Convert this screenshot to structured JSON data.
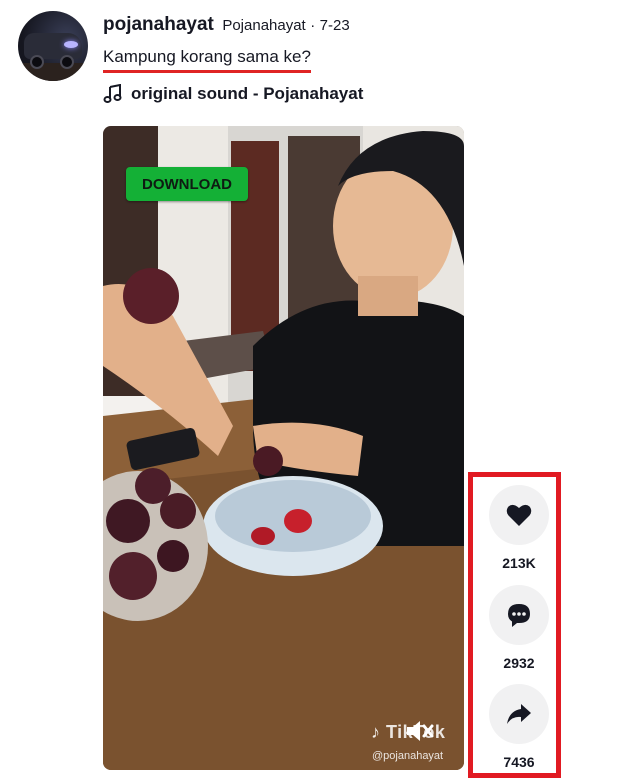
{
  "post": {
    "username": "pojanahayat",
    "nickname": "Pojanahayat",
    "separator": "·",
    "date": "7-23",
    "caption": "Kampung korang sama ke?",
    "music": "original sound - Pojanahayat"
  },
  "video": {
    "download_label": "DOWNLOAD",
    "watermark": "TikTok",
    "handle": "@pojanahayat"
  },
  "actions": {
    "likes": "213K",
    "comments": "2932",
    "shares": "7436",
    "highlight_color": "#e11a22"
  },
  "colors": {
    "caption_underline": "#e02424",
    "download_button": "#14b036"
  }
}
